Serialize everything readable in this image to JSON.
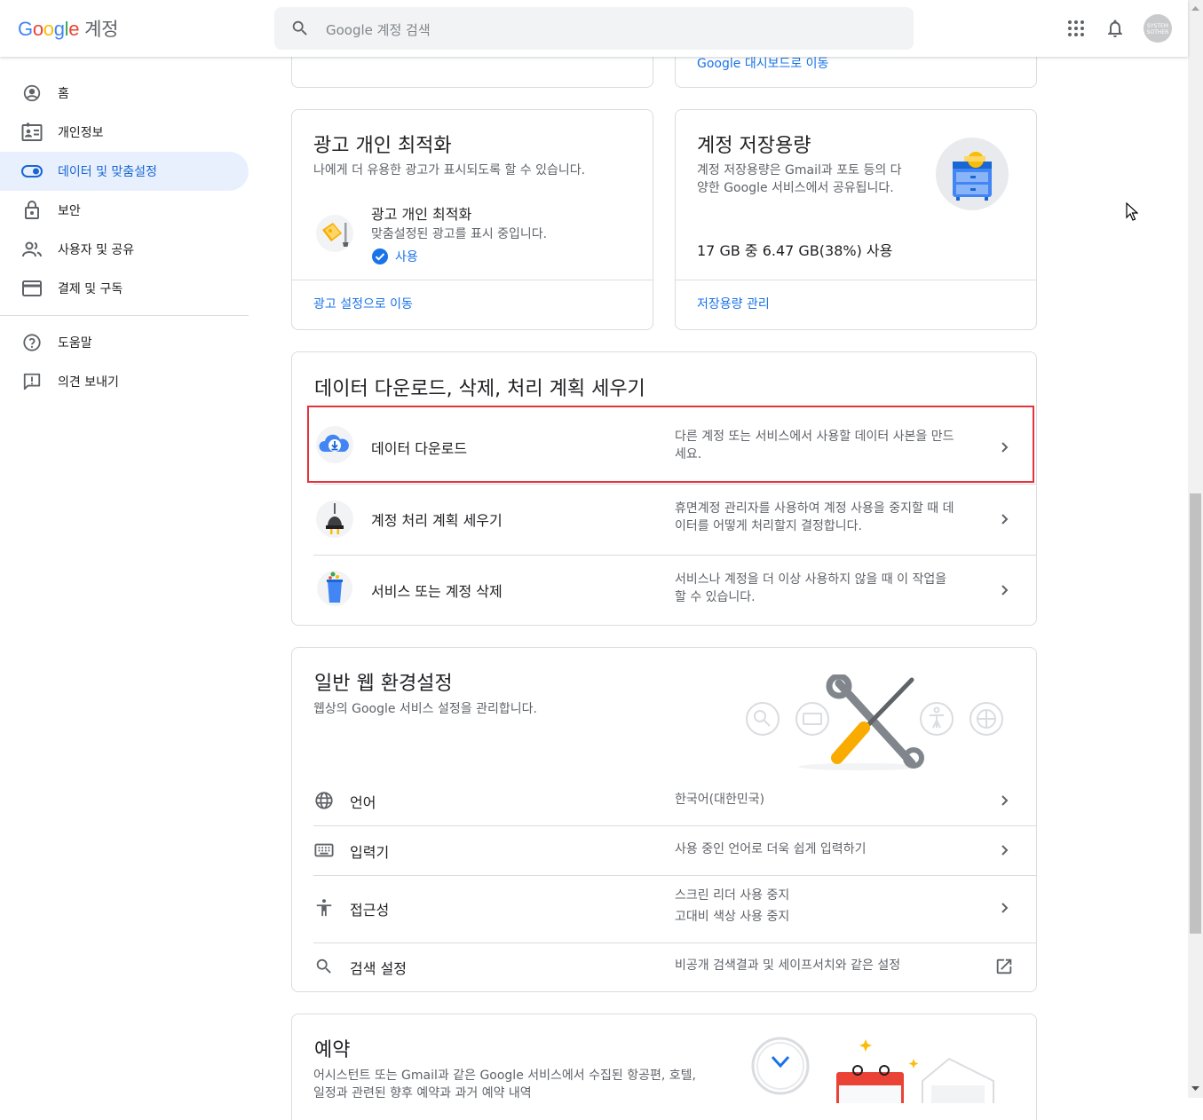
{
  "header": {
    "logo_text": "Google",
    "product_name": "계정",
    "search_placeholder": "Google 계정 검색",
    "apps_icon": "apps-grid-icon",
    "notifications_icon": "bell-icon",
    "avatar_text_1": "SYSTEM",
    "avatar_text_2": "SOTHER"
  },
  "sidebar": {
    "items": [
      {
        "label": "홈",
        "icon": "account-circle-icon"
      },
      {
        "label": "개인정보",
        "icon": "id-card-icon"
      },
      {
        "label": "데이터 및 맞춤설정",
        "icon": "toggle-icon",
        "active": true
      },
      {
        "label": "보안",
        "icon": "lock-icon"
      },
      {
        "label": "사용자 및 공유",
        "icon": "people-icon"
      },
      {
        "label": "결제 및 구독",
        "icon": "credit-card-icon"
      }
    ],
    "footer_items": [
      {
        "label": "도움말",
        "icon": "help-icon"
      },
      {
        "label": "의견 보내기",
        "icon": "feedback-icon"
      }
    ]
  },
  "top_partial": {
    "link": "Google 대시보드로 이동"
  },
  "ads_card": {
    "title": "광고 개인 최적화",
    "subtitle": "나에게 더 유용한 광고가 표시되도록 할 수 있습니다.",
    "item_title": "광고 개인 최적화",
    "item_desc": "맞춤설정된 광고를 표시 중입니다.",
    "status": "사용",
    "link": "광고 설정으로 이동"
  },
  "storage_card": {
    "title": "계정 저장용량",
    "subtitle_line1": "계정 저장용량은 Gmail과 포토 등의 다",
    "subtitle_line2": "양한 Google 서비스에서 공유됩니다.",
    "usage": "17 GB 중 6.47 GB(38%) 사용",
    "usage_fraction": 0.38,
    "link": "저장용량 관리"
  },
  "data_card": {
    "title": "데이터 다운로드, 삭제, 처리 계획 세우기",
    "rows": [
      {
        "label": "데이터 다운로드",
        "desc1": "다른 계정 또는 서비스에서 사용할 데이터 사본을 만드",
        "desc2": "세요."
      },
      {
        "label": "계정 처리 계획 세우기",
        "desc1": "휴면계정 관리자를 사용하여 계정 사용을 중지할 때 데",
        "desc2": "이터를 어떻게 처리할지 결정합니다."
      },
      {
        "label": "서비스 또는 계정 삭제",
        "desc1": "서비스나 계정을 더 이상 사용하지 않을 때 이 작업을",
        "desc2": "할 수 있습니다."
      }
    ]
  },
  "web_card": {
    "title": "일반 웹 환경설정",
    "subtitle": "웹상의 Google 서비스 설정을 관리합니다.",
    "rows": [
      {
        "label": "언어",
        "icon": "globe-icon",
        "desc1": "한국어(대한민국)",
        "desc2": ""
      },
      {
        "label": "입력기",
        "icon": "keyboard-icon",
        "desc1": "사용 중인 언어로 더욱 쉽게 입력하기",
        "desc2": ""
      },
      {
        "label": "접근성",
        "icon": "accessibility-icon",
        "desc1": "스크린 리더 사용 중지",
        "desc2": "고대비 색상 사용 중지"
      },
      {
        "label": "검색 설정",
        "icon": "search-icon",
        "desc1": "비공개 검색결과 및 세이프서치와 같은 설정",
        "desc2": ""
      }
    ]
  },
  "reservations_card": {
    "title": "예약",
    "subtitle_line1": "어시스턴트 또는 Gmail과 같은 Google 서비스에서 수집된 항공편, 호텔,",
    "subtitle_line2": "일정과 관련된 향후 예약과 과거 예약 내역"
  },
  "colors": {
    "accent": "#1a73e8",
    "active_bg": "#e8f0fe",
    "highlight_border": "#e5333b"
  }
}
